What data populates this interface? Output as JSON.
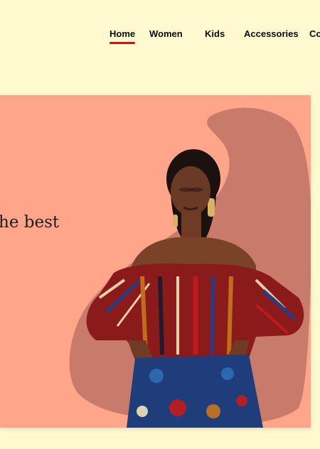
{
  "nav": {
    "items": [
      {
        "label": "Home",
        "active": true
      },
      {
        "label": "Women",
        "active": false
      },
      {
        "label": "Kids",
        "active": false
      },
      {
        "label": "Accessories",
        "active": false
      },
      {
        "label": "Co",
        "active": false
      }
    ]
  },
  "hero": {
    "headline": "he best",
    "image_alt": "woman in patterned off-shoulder top"
  },
  "colors": {
    "background": "#fff9cf",
    "hero_bg": "#ffa58a",
    "blob": "#c97b6b",
    "nav_active_underline": "#e30613"
  }
}
